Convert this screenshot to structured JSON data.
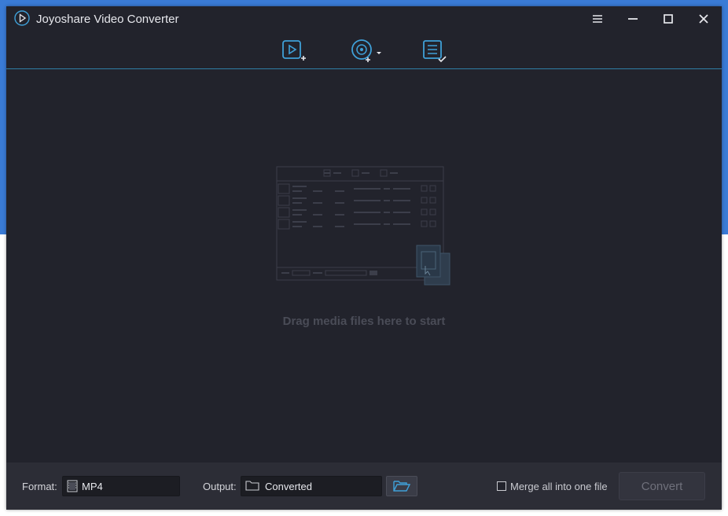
{
  "app": {
    "title": "Joyoshare Video Converter"
  },
  "window_controls": [
    "menu-icon",
    "minimize-icon",
    "maximize-icon",
    "close-icon"
  ],
  "toolbar": {
    "items": [
      "add-video-icon",
      "add-dvd-icon",
      "converted-list-icon"
    ]
  },
  "dropzone": {
    "hint": "Drag media files here to start"
  },
  "bottom": {
    "format_label": "Format:",
    "format_value": "MP4",
    "output_label": "Output:",
    "output_value": "Converted",
    "merge_label": "Merge all into one file",
    "merge_checked": false,
    "convert_label": "Convert"
  },
  "colors": {
    "accent": "#3fa0d8",
    "window_bg": "#22232c",
    "bottom_bg": "#2c2d36",
    "desktop": "#3a7bd6"
  }
}
